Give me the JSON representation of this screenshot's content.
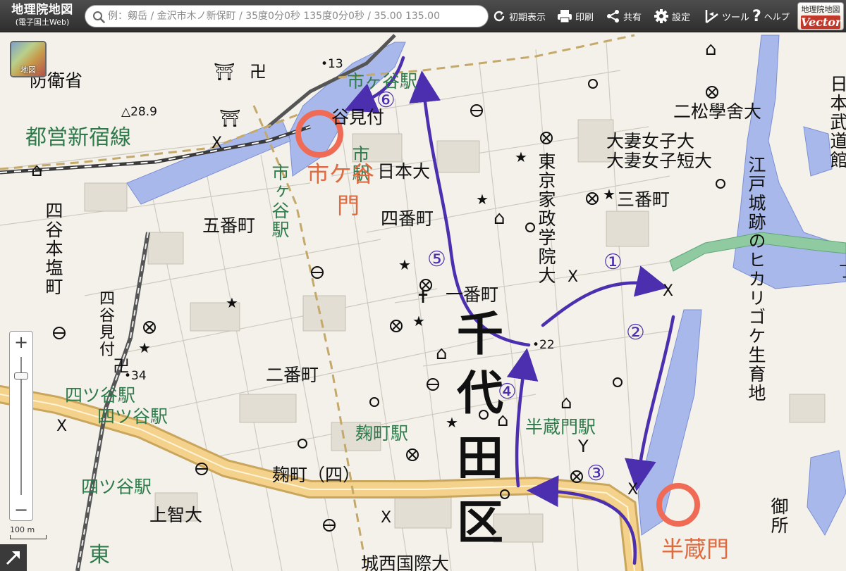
{
  "toolbar": {
    "title": "地理院地図",
    "subtitle": "(電子国土Web)",
    "search_placeholder": "例：剱岳 / 金沢市木ノ新保町 / 35度0分0秒 135度0分0秒 / 35.00 135.00",
    "buttons": {
      "initial": "初期表示",
      "print": "印刷",
      "share": "共有",
      "settings": "設定",
      "tools": "ツール",
      "help": "ヘルプ"
    },
    "logo_top": "地理院地図",
    "logo_bottom": "Vector"
  },
  "map": {
    "layer_button_label": "地図",
    "zoom_in": "+",
    "zoom_out": "−",
    "scale_label": "100 m",
    "labels": {
      "boeisho": "防衛省",
      "toei_shinjuku": "都営新宿線",
      "elev_28": "△28.9",
      "elev_13": "•13",
      "elev_22": "•22",
      "elev_34": "•34",
      "ichigaya_eki_top": "市ヶ谷駅",
      "ichigaya_mitsuke": "谷見付",
      "ichigaya_eki_v": "市ヶ谷駅",
      "ichigaya_eki_v2": "市駅",
      "ichigaya_orange": "市ケ谷",
      "ichigaya_orange2": "門",
      "nihon_dai": "日本大",
      "goban_cho": "五番町",
      "yonban_cho": "四番町",
      "yotsuya_honshiocho": "四谷本塩町",
      "yotsuya_mitsuke": "四谷見付",
      "yotsuya_eki_1": "四ツ谷駅",
      "yotsuya_eki_2": "四ツ谷駅",
      "yotsuya_eki_3": "四ツ谷駅",
      "niban_cho": "二番町",
      "ichiban_cho": "一番町",
      "kojimachi_eki": "麹町駅",
      "kojimachi_4": "麹町（四）",
      "jochi_dai": "上智大",
      "tokyo_kasei": "東京家政学院大",
      "nishogakusha": "二松學舍大",
      "otsuma_1": "大妻女子大",
      "otsuma_2": "大妻女子短大",
      "sanban_cho": "三番町",
      "hanzomon_eki": "半蔵門駅",
      "hanzomon_orange": "半蔵門",
      "edojo": "江戸城跡のヒカリゴケ生育地",
      "nihon_budokan": "日本武道館",
      "gosho": "御所",
      "chiyoda_1": "千",
      "chiyoda_2": "代",
      "chiyoda_3": "田",
      "chiyoda_4": "区",
      "higashi": "東",
      "shiro_kokusai": "城西国際大",
      "yo": "丁",
      "step_1": "①",
      "step_2": "②",
      "step_3": "③",
      "step_4": "④",
      "step_5": "⑤",
      "step_6": "⑥"
    }
  },
  "colors": {
    "route": "#4b2fae",
    "highlight_circle": "#ef6b55",
    "water": "#a9b8ea",
    "expressway": "#f4d28c",
    "railway": "#3a3a3a",
    "park": "#8fcaa0"
  }
}
